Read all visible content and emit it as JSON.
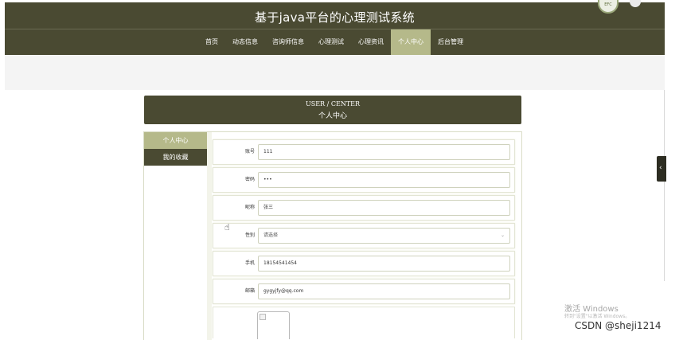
{
  "header": {
    "title": "基于java平台的心理测试系统",
    "avatar_text": "EFC"
  },
  "nav": {
    "items": [
      "首页",
      "动态信息",
      "咨询师信息",
      "心理测试",
      "心理资讯",
      "个人中心",
      "后台管理"
    ],
    "active_index": 5
  },
  "banner": {
    "en": "USER / CENTER",
    "cn": "个人中心"
  },
  "side_menu": {
    "items": [
      "个人中心",
      "我的收藏"
    ],
    "active_index": 0
  },
  "form": {
    "account": {
      "label": "账号",
      "value": "111"
    },
    "password": {
      "label": "密码",
      "value": "•••"
    },
    "nickname": {
      "label": "昵称",
      "value": "张三"
    },
    "gender": {
      "label": "性别",
      "placeholder": "请选择"
    },
    "phone": {
      "label": "手机",
      "value": "18154541454"
    },
    "email": {
      "label": "邮箱",
      "value": "gygyjfy@qq.com"
    }
  },
  "side_tab_glyph": "‹",
  "cursor_glyph": "☝",
  "select_caret": "⌄",
  "watermark": {
    "activate": "激活 Windows",
    "activate_sub": "转到\"设置\"以激活 Windows。",
    "csdn": "CSDN @sheji1214"
  },
  "colors": {
    "header_bg": "#4a4a32",
    "accent": "#b5b98a"
  }
}
